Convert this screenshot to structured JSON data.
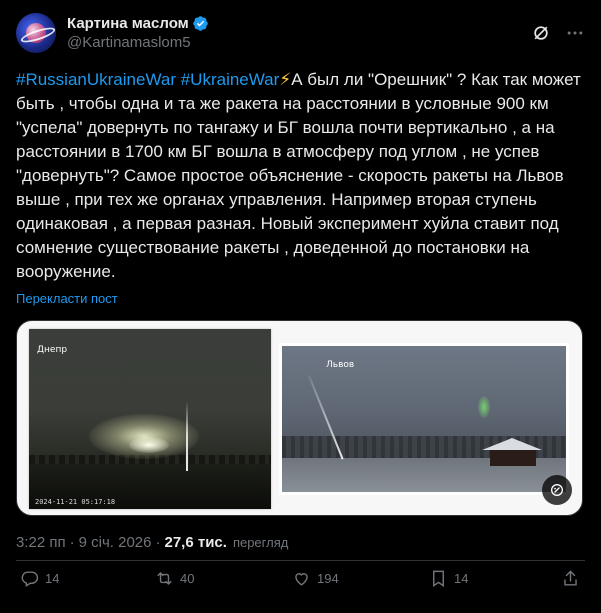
{
  "author": {
    "display_name": "Картина маслом",
    "handle": "@Kartinamaslom5",
    "verified": true
  },
  "header_icons": [
    "grok-icon",
    "more-icon"
  ],
  "post": {
    "hashtag_1": "#RussianUkraineWar",
    "hashtag_2": "#UkraineWar",
    "emoji": "⚡",
    "text": "А был ли \"Орешник\" ? Как так может быть , чтобы одна и та же ракета на расстоянии в условные 900 км \"успела\" довернуть по тангажу и БГ вошла почти вертикально , а на расстоянии в 1700 км БГ вошла в атмосферу под углом , не успев \"довернуть\"? Самое простое объяснение - скорость ракеты на Львов выше , при тех же органах управления. Например вторая ступень одинаковая , а первая разная. Новый эксперимент хуйла ставит под сомнение существование ракеты , доведенной до постановки на вооружение.",
    "translate_label": "Перекласти пост"
  },
  "media": {
    "left_photo": {
      "label": "Днепр",
      "timestamp": "2024-11-21 05:17:18"
    },
    "right_photo": {
      "label": "Львов"
    }
  },
  "meta": {
    "time": "3:22 пп",
    "separator": "·",
    "date": "9 січ. 2026",
    "views_count": "27,6 тис.",
    "views_label": "перегляд"
  },
  "actions": {
    "replies": "14",
    "reposts": "40",
    "likes": "194",
    "bookmarks": "14"
  },
  "colors": {
    "background": "#000000",
    "text": "#e7e9ea",
    "secondary": "#71767b",
    "accent": "#1d9bf0",
    "divider": "#2f3336"
  }
}
